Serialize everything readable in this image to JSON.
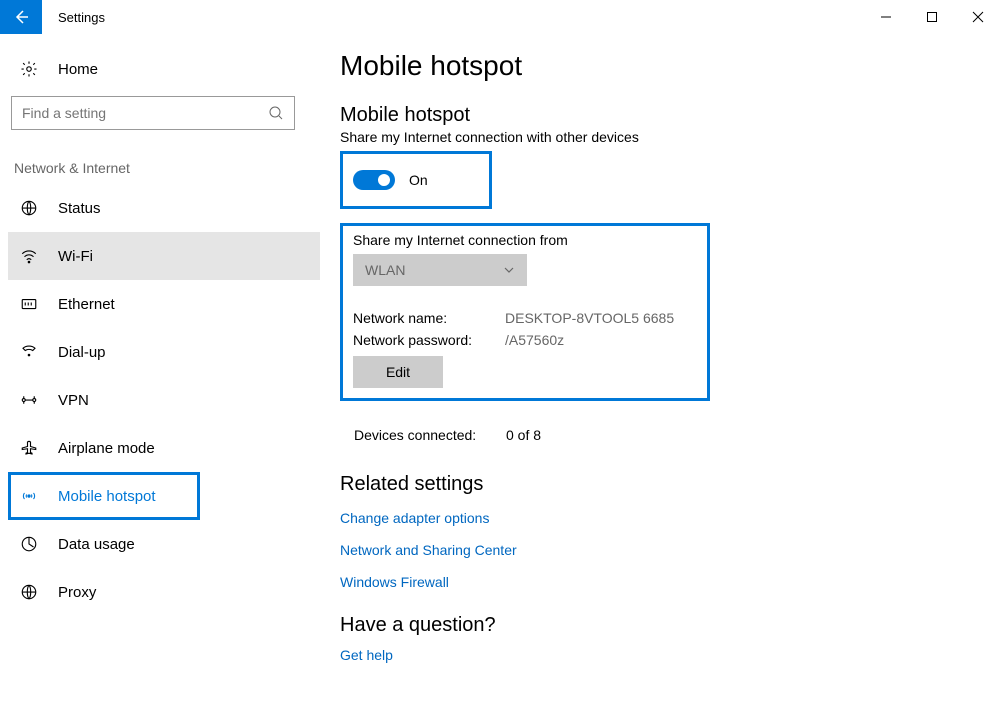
{
  "window": {
    "title": "Settings"
  },
  "sidebar": {
    "home": "Home",
    "search_placeholder": "Find a setting",
    "category": "Network & Internet",
    "items": [
      {
        "label": "Status"
      },
      {
        "label": "Wi-Fi"
      },
      {
        "label": "Ethernet"
      },
      {
        "label": "Dial-up"
      },
      {
        "label": "VPN"
      },
      {
        "label": "Airplane mode"
      },
      {
        "label": "Mobile hotspot"
      },
      {
        "label": "Data usage"
      },
      {
        "label": "Proxy"
      }
    ]
  },
  "page": {
    "title": "Mobile hotspot",
    "hotspot_heading": "Mobile hotspot",
    "share_text": "Share my Internet connection with other devices",
    "toggle_state": "On",
    "share_from_label": "Share my Internet connection from",
    "share_from_value": "WLAN",
    "net_name_label": "Network name:",
    "net_name_value": "DESKTOP-8VTOOL5 6685",
    "net_pass_label": "Network password:",
    "net_pass_value": "/A57560z",
    "edit_label": "Edit",
    "devices_label": "Devices connected:",
    "devices_value": "0 of 8",
    "related_heading": "Related settings",
    "links": {
      "adapter": "Change adapter options",
      "sharing": "Network and Sharing Center",
      "firewall": "Windows Firewall"
    },
    "question_heading": "Have a question?",
    "get_help": "Get help"
  }
}
